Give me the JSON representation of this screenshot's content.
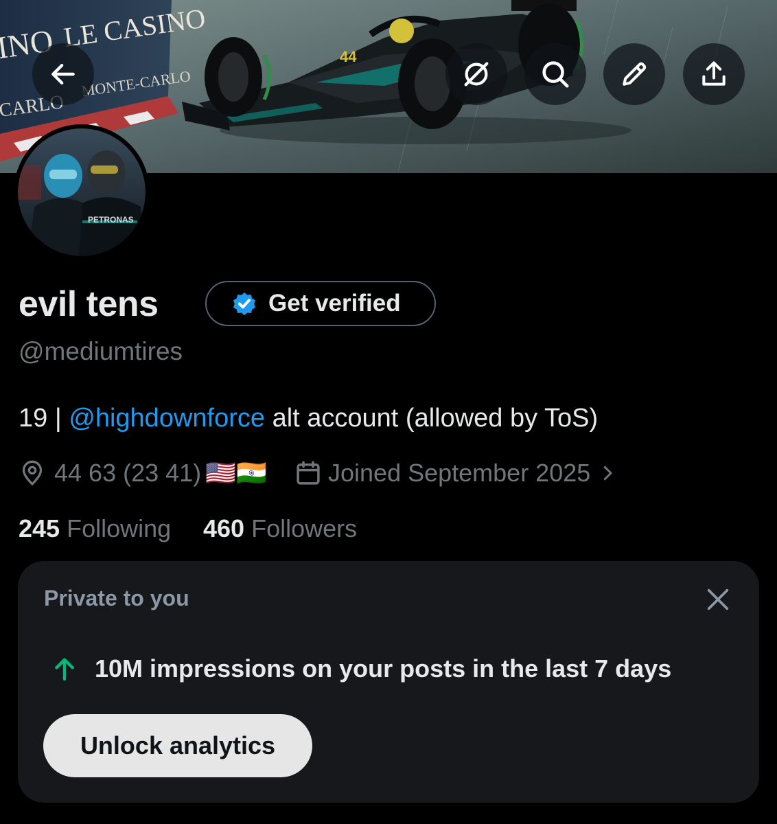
{
  "header": {
    "back_icon": "arrow-left-icon",
    "actions": [
      {
        "name": "grok-icon"
      },
      {
        "name": "search-icon"
      },
      {
        "name": "edit-icon"
      },
      {
        "name": "share-icon"
      }
    ],
    "banner_texts": {
      "casino_left": "INO",
      "le_casino": "LE CASINO",
      "carlo_left": "CARLO",
      "monte_carlo": "MONTE-CARLO",
      "car_number": "44"
    }
  },
  "profile": {
    "avatar_text": "PETRONAS",
    "display_name": "evil tens",
    "verify_label": "Get verified",
    "handle": "@mediumtires",
    "bio_prefix": "19 | ",
    "bio_mention": "@highdownforce",
    "bio_suffix": " alt account (allowed by ToS)",
    "location": "44 63 (23 41)",
    "flags": "🇺🇸🇮🇳",
    "joined": "Joined September 2025",
    "following_count": "245",
    "following_label": "Following",
    "followers_count": "460",
    "followers_label": "Followers"
  },
  "private_card": {
    "title": "Private to you",
    "stat": "10M impressions on your posts in the last 7 days",
    "button_label": "Unlock analytics"
  },
  "colors": {
    "background": "#000000",
    "text_primary": "#e7e9ea",
    "text_secondary": "#71767b",
    "link": "#1d9bf0",
    "verified_badge": "#1d9bf0",
    "stat_up": "#00ba7c",
    "card_bg": "#16181c"
  }
}
